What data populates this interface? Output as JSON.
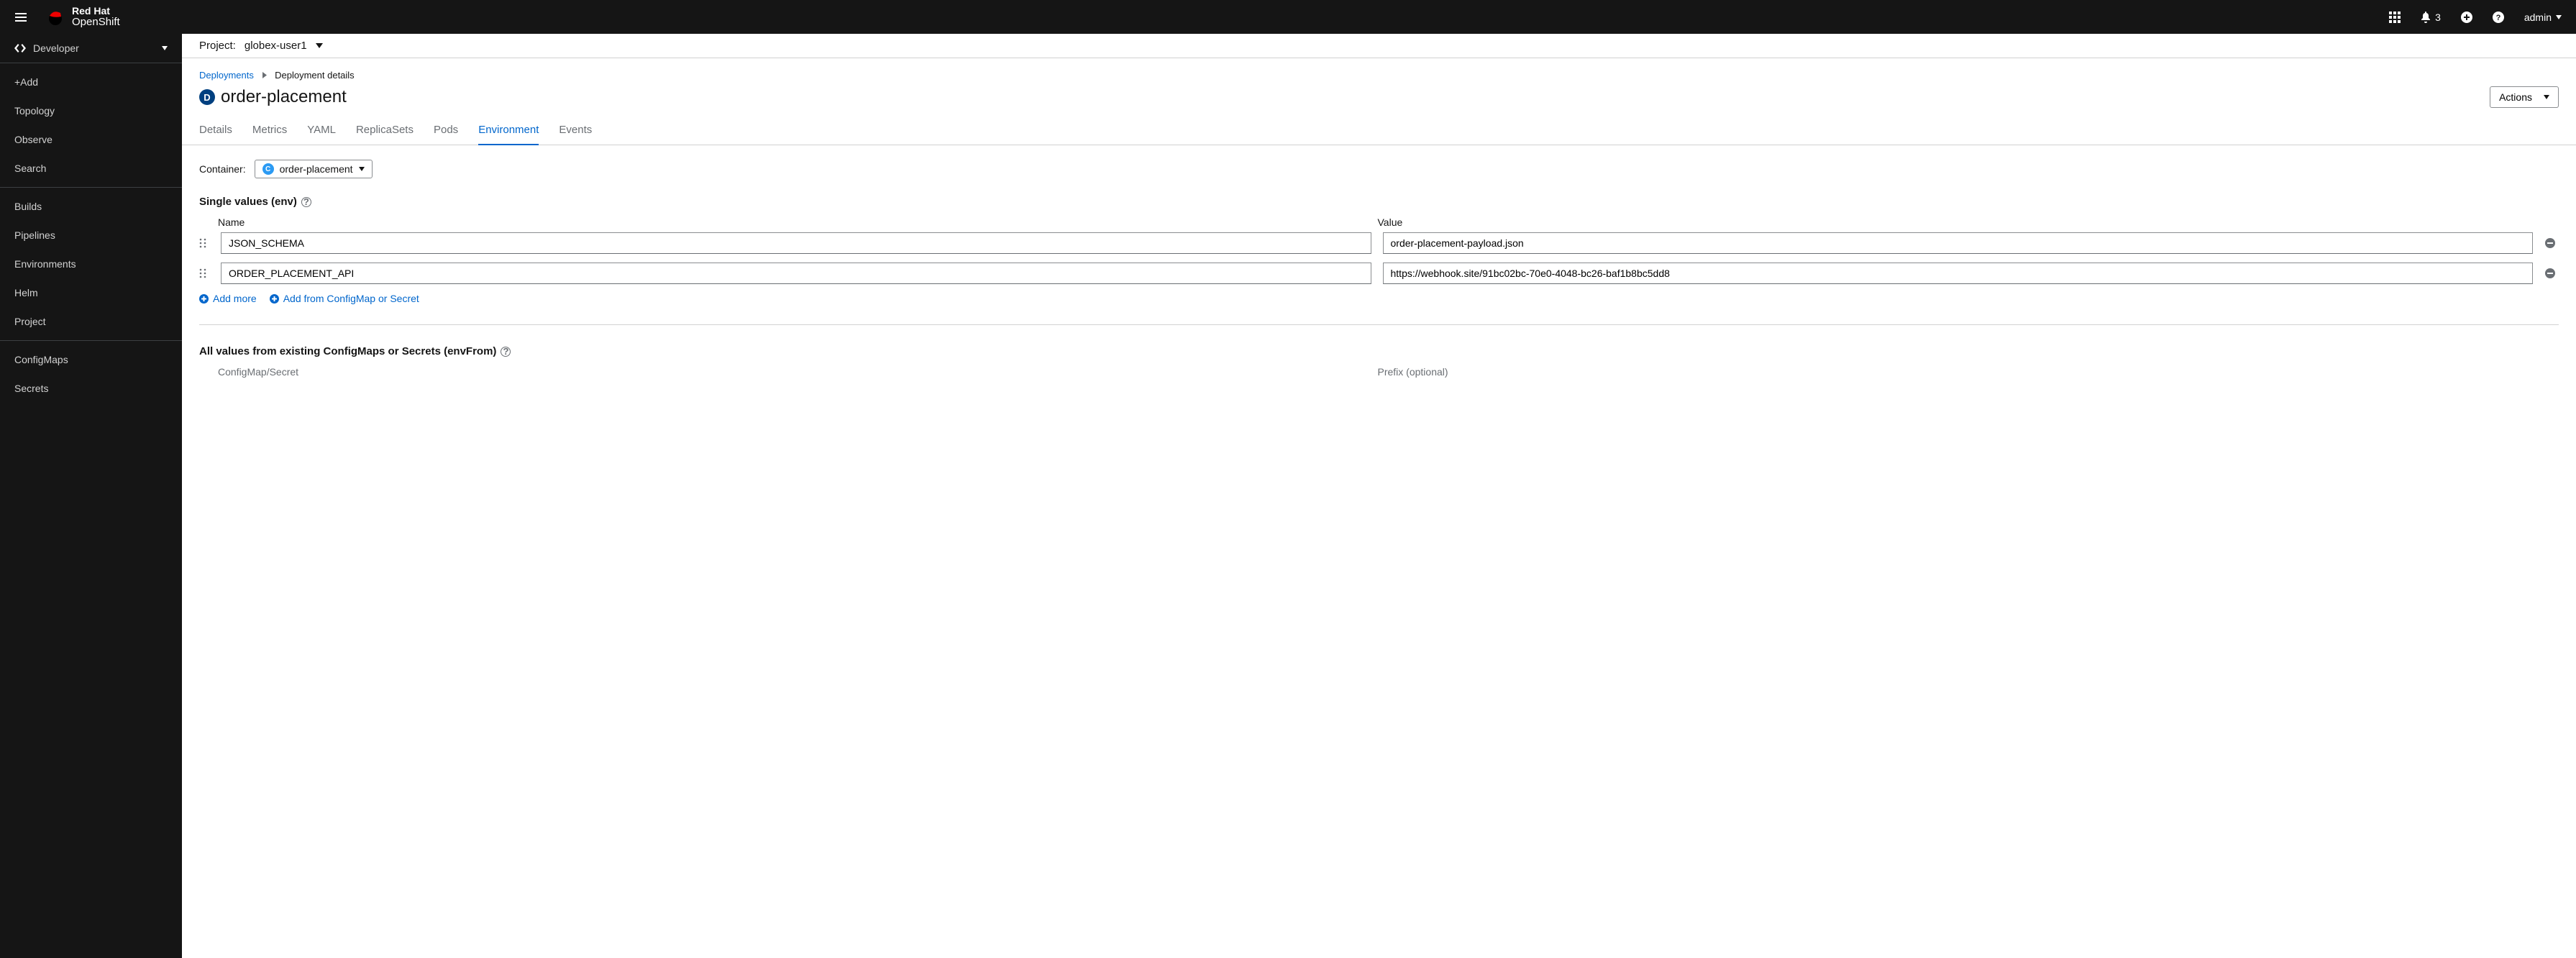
{
  "brand": {
    "title": "Red Hat",
    "product": "OpenShift"
  },
  "masthead": {
    "notification_count": "3",
    "user": "admin"
  },
  "sidebar": {
    "perspective": "Developer",
    "items_a": [
      "+Add",
      "Topology",
      "Observe",
      "Search"
    ],
    "items_b": [
      "Builds",
      "Pipelines",
      "Environments",
      "Helm",
      "Project"
    ],
    "items_c": [
      "ConfigMaps",
      "Secrets"
    ]
  },
  "project_bar": {
    "label": "Project:",
    "name": "globex-user1"
  },
  "breadcrumbs": {
    "parent": "Deployments",
    "current": "Deployment details"
  },
  "page": {
    "badge": "D",
    "title": "order-placement",
    "actions_label": "Actions"
  },
  "tabs": [
    "Details",
    "Metrics",
    "YAML",
    "ReplicaSets",
    "Pods",
    "Environment",
    "Events"
  ],
  "active_tab": "Environment",
  "container": {
    "label": "Container:",
    "badge": "C",
    "name": "order-placement"
  },
  "env_single": {
    "title": "Single values (env)",
    "headers": {
      "name": "Name",
      "value": "Value"
    },
    "rows": [
      {
        "name": "JSON_SCHEMA",
        "value": "order-placement-payload.json"
      },
      {
        "name": "ORDER_PLACEMENT_API",
        "value": "https://webhook.site/91bc02bc-70e0-4048-bc26-baf1b8bc5dd8"
      }
    ],
    "add_more": "Add more",
    "add_from": "Add from ConfigMap or Secret"
  },
  "env_from": {
    "title": "All values from existing ConfigMaps or Secrets (envFrom)",
    "headers": {
      "source": "ConfigMap/Secret",
      "prefix": "Prefix (optional)"
    }
  }
}
